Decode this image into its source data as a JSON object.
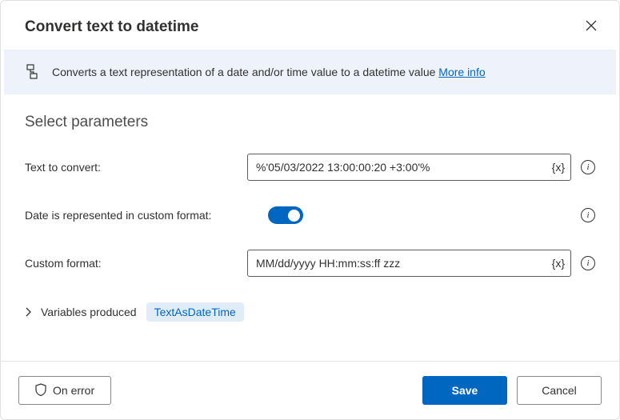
{
  "header": {
    "title": "Convert text to datetime"
  },
  "banner": {
    "text": "Converts a text representation of a date and/or time value to a datetime value ",
    "link_label": "More info"
  },
  "section": {
    "title": "Select parameters"
  },
  "fields": {
    "text_to_convert": {
      "label": "Text to convert:",
      "value": "%'05/03/2022 13:00:00:20 +3:00'%"
    },
    "custom_toggle": {
      "label": "Date is represented in custom format:",
      "on": true
    },
    "custom_format": {
      "label": "Custom format:",
      "value": "MM/dd/yyyy HH:mm:ss:ff zzz"
    }
  },
  "variables": {
    "label": "Variables produced",
    "badge": "TextAsDateTime"
  },
  "footer": {
    "on_error": "On error",
    "save": "Save",
    "cancel": "Cancel"
  }
}
